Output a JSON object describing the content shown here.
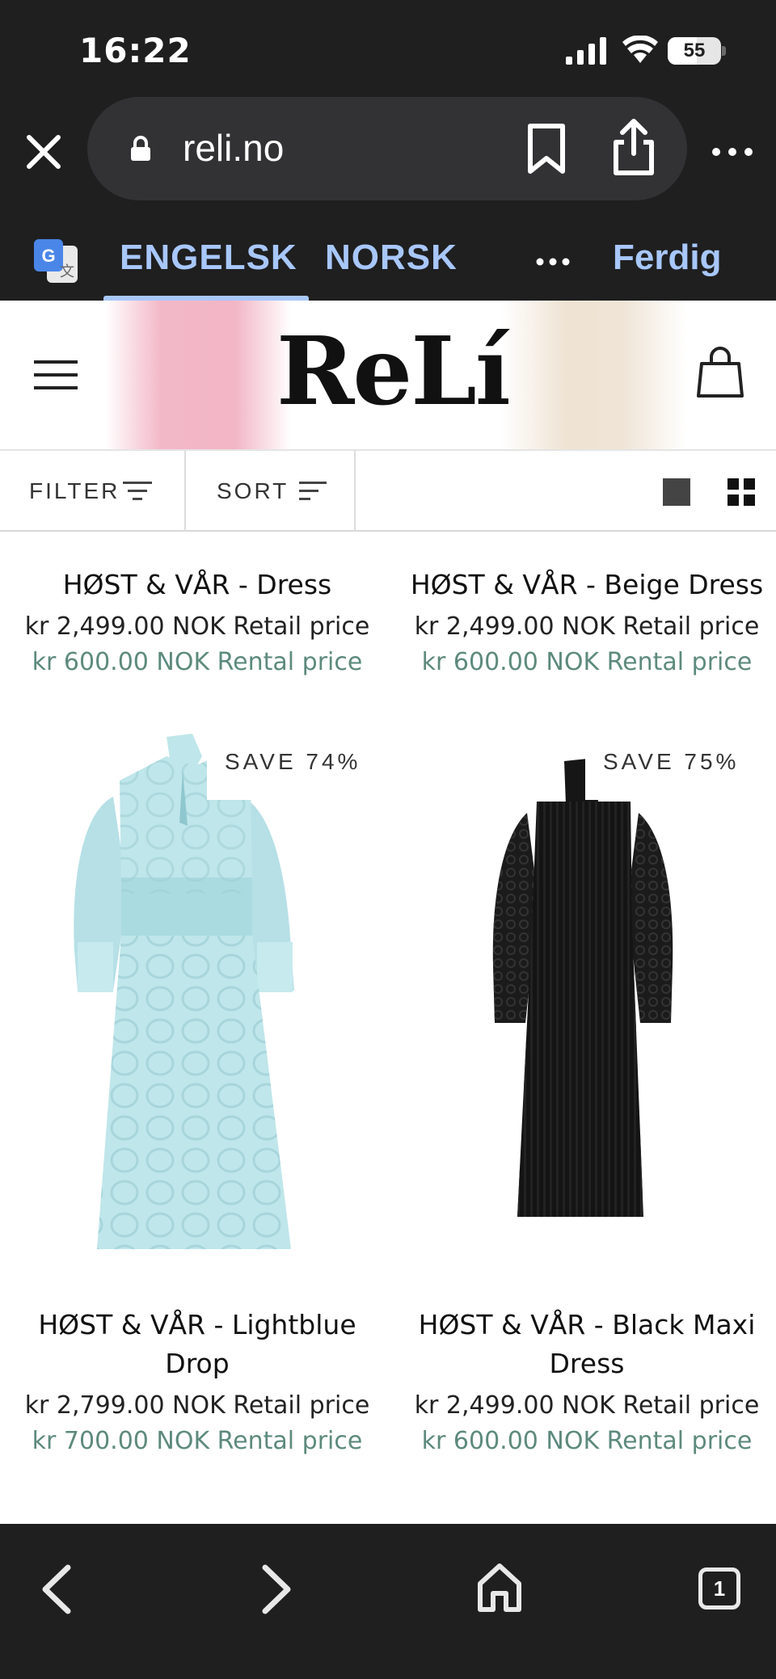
{
  "status_bar": {
    "time": "16:22",
    "battery": "55",
    "battery_level": 0.55
  },
  "browser": {
    "url": "reli.no",
    "translate": {
      "tab_english": "ENGELSK",
      "tab_norwegian": "NORSK",
      "done": "Ferdig"
    },
    "tab_count": "1"
  },
  "site": {
    "logo": "ReLí",
    "toolbar": {
      "filter_label": "FILTER",
      "sort_label": "SORT"
    }
  },
  "products": [
    {
      "title": "HØST & VÅR - Dress",
      "retail": "kr 2,499.00 NOK Retail price",
      "rental": "kr 600.00 NOK Rental price"
    },
    {
      "title": "HØST & VÅR - Beige Dress",
      "retail": "kr 2,499.00 NOK Retail price",
      "rental": "kr 600.00 NOK Rental price"
    },
    {
      "title": "HØST & VÅR - Lightblue Drop",
      "retail": "kr 2,799.00 NOK Retail price",
      "rental": "kr 700.00 NOK Rental price",
      "badge": "SAVE 74%"
    },
    {
      "title": "HØST & VÅR - Black Maxi Dress",
      "retail": "kr 2,499.00 NOK Retail price",
      "rental": "kr 600.00 NOK Rental price",
      "badge": "SAVE 75%"
    }
  ],
  "colors": {
    "browser_chrome": "#1f1f20",
    "translate_accent": "#a8c7fa",
    "rental_price": "#5d8a7d",
    "lightblue_dress": "#bfe6ea",
    "black_dress": "#161616"
  }
}
